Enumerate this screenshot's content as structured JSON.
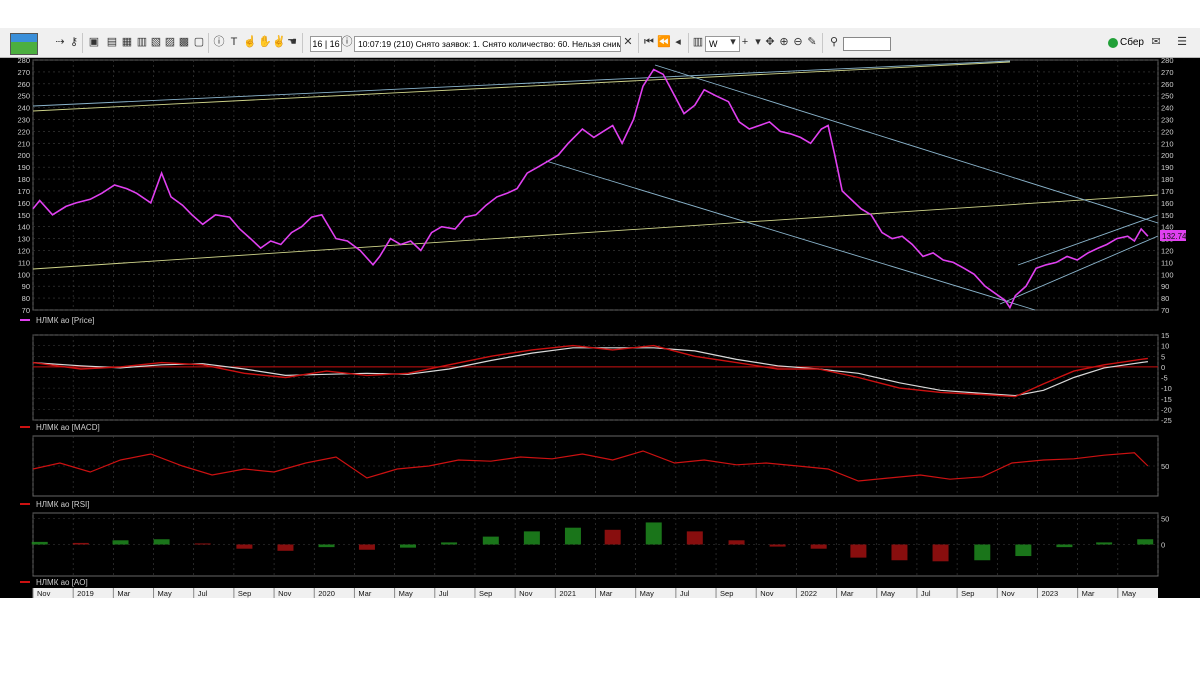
{
  "toolbar": {
    "counter": "16 | 16",
    "message": "10:07:19  (210) Снято заявок: 1. Снято количество: 60. Нельзя снимать: 0.",
    "period": "W",
    "broker": "Сбер"
  },
  "colors": {
    "price": "#e040f0",
    "grid": "#404040",
    "trend_lines": "#8ab4cc",
    "support_line": "#cfd48a",
    "macd_signal": "#d8d8d8",
    "indicator_red": "#cc1111",
    "ao_up": "#1f8a1f",
    "ao_down": "#a01010"
  },
  "chart_data": [
    {
      "type": "line",
      "legend": "НЛМК ао [Price]",
      "price_label": "132.74",
      "ylim": [
        70,
        280
      ],
      "y_ticks": [
        70,
        80,
        90,
        100,
        110,
        120,
        130,
        140,
        150,
        160,
        170,
        180,
        190,
        200,
        210,
        220,
        230,
        240,
        250,
        260,
        270,
        280
      ],
      "x_ticks": [
        "Nov",
        "2019",
        "Mar",
        "May",
        "Jul",
        "Sep",
        "Nov",
        "2020",
        "Mar",
        "May",
        "Jul",
        "Sep",
        "Nov",
        "2021",
        "Mar",
        "May",
        "Jul",
        "Sep",
        "Nov",
        "2022",
        "Mar",
        "May",
        "Jul",
        "Sep",
        "Nov",
        "2023",
        "Mar",
        "May"
      ],
      "x_range": [
        "2018-10-22",
        "2023-05-20"
      ],
      "series": [
        {
          "x": [
            "2018-10-22",
            "2018-11-01",
            "2018-11-20",
            "2018-12-10",
            "2018-12-25",
            "2019-01-15",
            "2019-02-01",
            "2019-02-20",
            "2019-03-10",
            "2019-03-25",
            "2019-04-15",
            "2019-05-01",
            "2019-05-15",
            "2019-06-01",
            "2019-06-15",
            "2019-07-01",
            "2019-07-20",
            "2019-08-10",
            "2019-08-25",
            "2019-09-10",
            "2019-09-25",
            "2019-10-10",
            "2019-10-25",
            "2019-11-10",
            "2019-11-25",
            "2019-12-10",
            "2019-12-25",
            "2020-01-15",
            "2020-02-01",
            "2020-02-20",
            "2020-03-10",
            "2020-03-20",
            "2020-04-05",
            "2020-04-20",
            "2020-05-05",
            "2020-05-20",
            "2020-06-05",
            "2020-06-20",
            "2020-07-10",
            "2020-07-25",
            "2020-08-10",
            "2020-08-25",
            "2020-09-10",
            "2020-09-25",
            "2020-10-10",
            "2020-10-25",
            "2020-11-10",
            "2020-11-25",
            "2020-12-10",
            "2020-12-25",
            "2021-01-15",
            "2021-02-01",
            "2021-02-15",
            "2021-03-01",
            "2021-03-15",
            "2021-04-01",
            "2021-04-15",
            "2021-05-01",
            "2021-05-15",
            "2021-06-01",
            "2021-06-15",
            "2021-07-01",
            "2021-07-15",
            "2021-08-01",
            "2021-08-20",
            "2021-09-05",
            "2021-09-20",
            "2021-10-05",
            "2021-10-20",
            "2021-11-05",
            "2021-11-20",
            "2021-12-05",
            "2021-12-20",
            "2022-01-05",
            "2022-01-15",
            "2022-01-25",
            "2022-02-05",
            "2022-02-20",
            "2022-03-05",
            "2022-03-20",
            "2022-04-05",
            "2022-04-20",
            "2022-05-05",
            "2022-05-20",
            "2022-06-05",
            "2022-06-20",
            "2022-07-05",
            "2022-07-20",
            "2022-08-05",
            "2022-08-20",
            "2022-09-05",
            "2022-09-20",
            "2022-10-05",
            "2022-10-12",
            "2022-10-20",
            "2022-11-05",
            "2022-11-20",
            "2022-12-05",
            "2022-12-20",
            "2023-01-05",
            "2023-01-20",
            "2023-02-05",
            "2023-02-20",
            "2023-03-05",
            "2023-03-20",
            "2023-04-05",
            "2023-04-15",
            "2023-04-25",
            "2023-05-05"
          ],
          "y": [
            155,
            162,
            150,
            157,
            160,
            163,
            168,
            175,
            172,
            168,
            160,
            185,
            165,
            158,
            150,
            142,
            150,
            148,
            138,
            130,
            122,
            128,
            125,
            135,
            140,
            148,
            150,
            130,
            128,
            120,
            108,
            115,
            130,
            125,
            128,
            120,
            135,
            140,
            138,
            148,
            150,
            158,
            165,
            168,
            172,
            185,
            190,
            195,
            200,
            210,
            222,
            215,
            220,
            225,
            210,
            230,
            258,
            272,
            268,
            250,
            235,
            242,
            255,
            250,
            245,
            228,
            222,
            225,
            228,
            220,
            218,
            215,
            210,
            222,
            225,
            200,
            170,
            162,
            155,
            150,
            135,
            130,
            132,
            125,
            115,
            118,
            112,
            110,
            105,
            100,
            90,
            84,
            78,
            72,
            82,
            90,
            105,
            108,
            110,
            115,
            112,
            118,
            122,
            125,
            130,
            132,
            128,
            138,
            132
          ]
        }
      ],
      "trendlines": 6
    },
    {
      "type": "line",
      "legend": "НЛМК ао [MACD]",
      "ylim": [
        -25,
        15
      ],
      "y_ticks": [
        -25,
        -20,
        -15,
        -10,
        -5,
        0,
        5,
        10,
        15
      ],
      "series": [
        {
          "x": [
            "2018-10-22",
            "2019-01-01",
            "2019-03-01",
            "2019-05-01",
            "2019-07-01",
            "2019-09-01",
            "2019-11-01",
            "2020-01-01",
            "2020-03-01",
            "2020-05-01",
            "2020-07-01",
            "2020-09-01",
            "2020-11-01",
            "2021-01-01",
            "2021-03-01",
            "2021-05-01",
            "2021-07-01",
            "2021-09-01",
            "2021-11-01",
            "2022-01-01",
            "2022-03-01",
            "2022-05-01",
            "2022-07-01",
            "2022-09-01",
            "2022-10-20",
            "2022-12-01",
            "2023-01-15",
            "2023-03-01",
            "2023-05-05"
          ],
          "y": [
            2,
            -1,
            0,
            2,
            1,
            -3,
            -5,
            -2,
            -4,
            -3,
            1,
            5,
            8,
            10,
            8,
            10,
            5,
            2,
            -1,
            -1,
            -5,
            -10,
            -12,
            -13,
            -14,
            -8,
            -2,
            1,
            4
          ]
        }
      ]
    },
    {
      "type": "line",
      "legend": "НЛМК ао [RSI]",
      "ylim": [
        0,
        100
      ],
      "y_ticks": [
        50
      ],
      "series": [
        {
          "x": [
            "2018-10-22",
            "2018-12-01",
            "2019-01-15",
            "2019-03-01",
            "2019-04-15",
            "2019-06-01",
            "2019-07-15",
            "2019-09-01",
            "2019-10-15",
            "2019-12-01",
            "2020-01-15",
            "2020-03-01",
            "2020-04-15",
            "2020-06-01",
            "2020-07-15",
            "2020-09-01",
            "2020-10-15",
            "2020-12-01",
            "2021-01-15",
            "2021-03-01",
            "2021-04-15",
            "2021-06-01",
            "2021-07-15",
            "2021-09-01",
            "2021-10-15",
            "2021-12-01",
            "2022-01-15",
            "2022-03-01",
            "2022-04-15",
            "2022-06-01",
            "2022-07-15",
            "2022-09-01",
            "2022-10-15",
            "2022-12-01",
            "2023-01-15",
            "2023-03-01",
            "2023-04-15",
            "2023-05-05"
          ],
          "y": [
            45,
            55,
            40,
            60,
            70,
            50,
            35,
            45,
            40,
            55,
            65,
            30,
            45,
            50,
            60,
            58,
            65,
            62,
            70,
            60,
            75,
            55,
            60,
            52,
            55,
            50,
            45,
            25,
            30,
            35,
            28,
            32,
            55,
            60,
            62,
            68,
            72,
            50
          ]
        }
      ]
    },
    {
      "type": "bar",
      "legend": "НЛМК ао [AO]",
      "ylim": [
        -60,
        60
      ],
      "y_ticks": [
        0,
        50
      ],
      "series": [
        {
          "x": [
            "2018-11-01",
            "2019-01-01",
            "2019-03-01",
            "2019-05-01",
            "2019-07-01",
            "2019-09-01",
            "2019-11-01",
            "2020-01-01",
            "2020-03-01",
            "2020-05-01",
            "2020-07-01",
            "2020-09-01",
            "2020-11-01",
            "2021-01-01",
            "2021-03-01",
            "2021-05-01",
            "2021-07-01",
            "2021-09-01",
            "2021-11-01",
            "2022-01-01",
            "2022-03-01",
            "2022-05-01",
            "2022-07-01",
            "2022-09-01",
            "2022-11-01",
            "2023-01-01",
            "2023-03-01",
            "2023-05-01"
          ],
          "y": [
            5,
            3,
            8,
            10,
            2,
            -8,
            -12,
            -5,
            -10,
            -6,
            4,
            15,
            25,
            32,
            28,
            42,
            25,
            8,
            -4,
            -8,
            -25,
            -30,
            -32,
            -30,
            -22,
            -5,
            4,
            10
          ]
        }
      ]
    }
  ]
}
